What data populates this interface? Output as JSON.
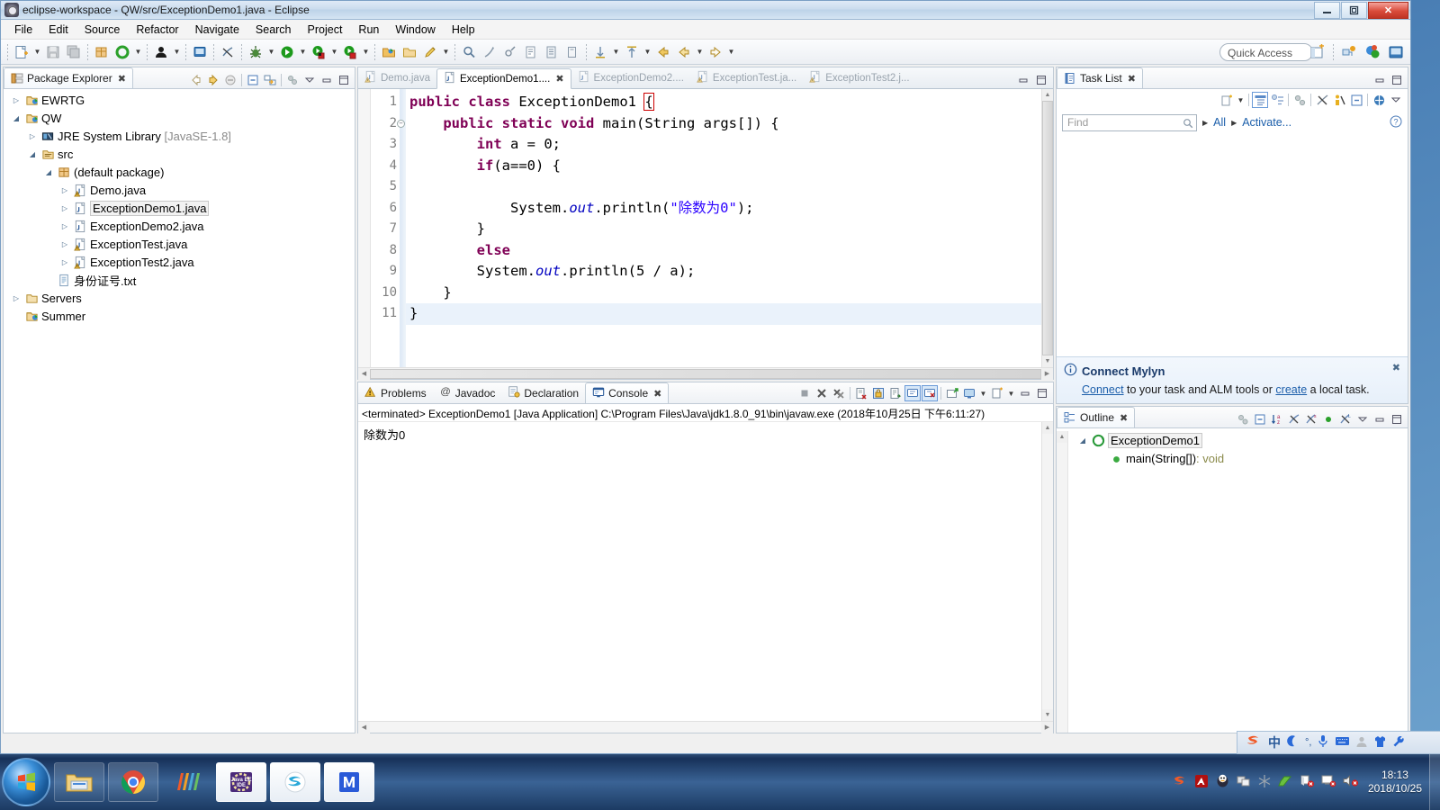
{
  "window": {
    "title": "eclipse-workspace - QW/src/ExceptionDemo1.java - Eclipse",
    "icon": "eclipse-icon",
    "minimize_label": "–",
    "maximize_label": "❐",
    "close_label": "✕"
  },
  "menu": {
    "items": [
      "File",
      "Edit",
      "Source",
      "Refactor",
      "Navigate",
      "Search",
      "Project",
      "Run",
      "Window",
      "Help"
    ]
  },
  "toolbar": {
    "quick_access_placeholder": "Quick Access",
    "quick_access_value": "Quick Access",
    "items": [
      {
        "name": "new-wizard-icon"
      },
      {
        "name": "new-dropdown-arrow"
      },
      {
        "name": "save-icon"
      },
      {
        "name": "save-all-icon"
      },
      {
        "name": "new-java-package-icon"
      },
      {
        "name": "refresh-icon"
      },
      {
        "name": "refresh-dropdown-arrow"
      },
      {
        "name": "open-type-icon"
      },
      {
        "name": "open-type-dropdown-arrow"
      },
      {
        "name": "new-java-class-icon"
      },
      {
        "name": "skip-breakpoints-icon"
      },
      {
        "name": "debug-icon"
      },
      {
        "name": "debug-dropdown-arrow"
      },
      {
        "name": "run-icon"
      },
      {
        "name": "run-dropdown-arrow"
      },
      {
        "name": "run-external-tools-icon"
      },
      {
        "name": "external-tools-dropdown-arrow"
      },
      {
        "name": "coverage-icon"
      },
      {
        "name": "coverage-dropdown-arrow"
      },
      {
        "name": "open-perspective-icon"
      },
      {
        "name": "open-resource-icon"
      },
      {
        "name": "pencil-icon"
      },
      {
        "name": "pencil-dropdown-arrow"
      },
      {
        "name": "search-icon"
      },
      {
        "name": "hierarchy-icon"
      },
      {
        "name": "annotation-icon"
      },
      {
        "name": "next-annotation-icon"
      },
      {
        "name": "previous-annotation-icon"
      },
      {
        "name": "last-edit-icon"
      },
      {
        "name": "toggle-mark-icon"
      },
      {
        "name": "mark-dropdown-arrow"
      },
      {
        "name": "next-edit-icon"
      },
      {
        "name": "next-edit-dropdown-arrow"
      },
      {
        "name": "back-icon"
      },
      {
        "name": "back-history-icon"
      },
      {
        "name": "back-dropdown-arrow"
      },
      {
        "name": "forward-icon"
      },
      {
        "name": "forward-dropdown-arrow"
      }
    ],
    "perspective_buttons": [
      {
        "name": "open-perspective-button"
      },
      {
        "name": "perspective-java-ee-button"
      },
      {
        "name": "perspective-java-button"
      },
      {
        "name": "perspective-debug-button"
      }
    ]
  },
  "package_explorer": {
    "title": "Package Explorer",
    "close_label": "✖",
    "tools": [
      {
        "name": "back-arrow-icon"
      },
      {
        "name": "forward-arrow-icon"
      },
      {
        "name": "collapse-to-parent-icon"
      },
      {
        "name": "collapse-all-icon"
      },
      {
        "name": "link-with-editor-icon"
      },
      {
        "name": "view-menu-icon"
      },
      {
        "name": "minimize-view-icon"
      },
      {
        "name": "maximize-view-icon"
      }
    ],
    "tree": [
      {
        "label": "EWRTG",
        "indent": 0,
        "twisty": "collapsed",
        "icon": "java-project-icon",
        "selected": false
      },
      {
        "label": "QW",
        "indent": 0,
        "twisty": "expanded",
        "icon": "java-project-icon",
        "selected": false
      },
      {
        "label": "JRE System Library",
        "suffix": "[JavaSE-1.8]",
        "indent": 1,
        "twisty": "collapsed",
        "icon": "library-icon",
        "selected": false
      },
      {
        "label": "src",
        "indent": 1,
        "twisty": "expanded",
        "icon": "source-folder-icon",
        "selected": false
      },
      {
        "label": "(default package)",
        "indent": 2,
        "twisty": "expanded",
        "icon": "package-icon",
        "selected": false
      },
      {
        "label": "Demo.java",
        "indent": 3,
        "twisty": "collapsed",
        "icon": "java-file-warning-icon",
        "selected": false
      },
      {
        "label": "ExceptionDemo1.java",
        "indent": 3,
        "twisty": "collapsed",
        "icon": "java-file-icon",
        "selected": true
      },
      {
        "label": "ExceptionDemo2.java",
        "indent": 3,
        "twisty": "collapsed",
        "icon": "java-file-icon",
        "selected": false
      },
      {
        "label": "ExceptionTest.java",
        "indent": 3,
        "twisty": "collapsed",
        "icon": "java-file-warning-icon",
        "selected": false
      },
      {
        "label": "ExceptionTest2.java",
        "indent": 3,
        "twisty": "collapsed",
        "icon": "java-file-warning-icon",
        "selected": false
      },
      {
        "label": "身份证号.txt",
        "indent": 2,
        "twisty": "none",
        "icon": "text-file-icon",
        "selected": false
      },
      {
        "label": "Servers",
        "indent": 0,
        "twisty": "collapsed",
        "icon": "folder-icon",
        "selected": false
      },
      {
        "label": "Summer",
        "indent": 0,
        "twisty": "none",
        "icon": "java-project-icon",
        "selected": false
      }
    ]
  },
  "editor": {
    "tabs": [
      {
        "label": "Demo.java",
        "active": false,
        "icon": "java-file-warning-icon",
        "close": ""
      },
      {
        "label": "ExceptionDemo1....",
        "active": true,
        "icon": "java-file-icon",
        "close": "✖"
      },
      {
        "label": "ExceptionDemo2....",
        "active": false,
        "icon": "java-file-icon",
        "close": ""
      },
      {
        "label": "ExceptionTest.ja...",
        "active": false,
        "icon": "java-file-warning-icon",
        "close": ""
      },
      {
        "label": "ExceptionTest2.j...",
        "active": false,
        "icon": "java-file-warning-icon",
        "close": ""
      }
    ],
    "tab_tools": [
      {
        "name": "minimize-editor-icon"
      },
      {
        "name": "maximize-editor-icon"
      }
    ],
    "line_numbers": [
      "1",
      "2",
      "3",
      "4",
      "5",
      "6",
      "7",
      "8",
      "9",
      "10",
      "11"
    ],
    "fold_line": "2",
    "current_line": 11,
    "code_lines": [
      "public class ExceptionDemo1 {",
      "    public static void main(String args[]) {",
      "        int a = 0;",
      "        if(a==0) {",
      "",
      "            System.out.println(\"除数为0\");",
      "        }",
      "        else",
      "        System.out.println(5 / a);",
      "    }",
      "}"
    ]
  },
  "console": {
    "tabs": [
      {
        "label": "Problems",
        "active": false,
        "icon": "problems-icon"
      },
      {
        "label": "Javadoc",
        "active": false,
        "icon": "javadoc-icon"
      },
      {
        "label": "Declaration",
        "active": false,
        "icon": "declaration-icon"
      },
      {
        "label": "Console",
        "active": true,
        "icon": "console-icon"
      }
    ],
    "close_label": "✖",
    "tools": [
      {
        "name": "terminate-icon"
      },
      {
        "name": "remove-launch-icon"
      },
      {
        "name": "remove-all-terminated-icon"
      },
      {
        "name": "clear-console-icon"
      },
      {
        "name": "scroll-lock-icon"
      },
      {
        "name": "word-wrap-icon"
      },
      {
        "name": "show-console-on-output-icon"
      },
      {
        "name": "show-console-on-error-icon"
      },
      {
        "name": "pin-console-icon"
      },
      {
        "name": "display-selected-console-icon"
      },
      {
        "name": "display-console-dropdown-arrow"
      },
      {
        "name": "open-console-icon"
      },
      {
        "name": "open-console-dropdown-arrow"
      },
      {
        "name": "minimize-console-icon"
      },
      {
        "name": "maximize-console-icon"
      }
    ],
    "launch_line": "<terminated> ExceptionDemo1 [Java Application] C:\\Program Files\\Java\\jdk1.8.0_91\\bin\\javaw.exe (2018年10月25日 下午6:11:27)",
    "output": "除数为0"
  },
  "task_list": {
    "title": "Task List",
    "close_label": "✖",
    "tools": [
      {
        "name": "new-task-icon"
      },
      {
        "name": "new-task-dropdown-arrow"
      },
      {
        "name": "categorized-presentation-icon"
      },
      {
        "name": "scheduled-presentation-icon"
      },
      {
        "name": "focus-on-workweek-icon"
      },
      {
        "name": "filter-completed-icon"
      },
      {
        "name": "focus-active-task-icon"
      },
      {
        "name": "collapse-all-icon"
      },
      {
        "name": "synchronize-changed-icon"
      },
      {
        "name": "view-menu-icon"
      },
      {
        "name": "minimize-view-icon"
      },
      {
        "name": "maximize-view-icon"
      }
    ],
    "find_placeholder": "Find",
    "find_value": "",
    "filter_all_label": "All",
    "activate_label": "Activate...",
    "mylyn": {
      "title": "Connect Mylyn",
      "info_icon": "info-icon",
      "text_prefix": "",
      "link_connect": "Connect",
      "text_middle": " to your task and ALM tools or ",
      "link_create": "create",
      "text_suffix": " a local task.",
      "close_label": "✖"
    }
  },
  "outline": {
    "title": "Outline",
    "close_label": "✖",
    "tools": [
      {
        "name": "focus-active-task-icon"
      },
      {
        "name": "collapse-all-icon"
      },
      {
        "name": "sort-alphabetically-icon"
      },
      {
        "name": "hide-fields-icon"
      },
      {
        "name": "hide-static-icon"
      },
      {
        "name": "hide-non-public-icon"
      },
      {
        "name": "hide-local-types-icon"
      },
      {
        "name": "view-menu-icon"
      },
      {
        "name": "minimize-view-icon"
      },
      {
        "name": "maximize-view-icon"
      }
    ],
    "items": [
      {
        "label": "ExceptionDemo1",
        "indent": 0,
        "twisty": "expanded",
        "icon": "java-class-icon",
        "type_suffix": "",
        "selected": true
      },
      {
        "label": "main(String[])",
        "type_suffix": " : void",
        "indent": 1,
        "twisty": "none",
        "icon": "public-static-method-icon",
        "selected": false
      }
    ]
  },
  "taskbar": {
    "start_label": "start-orb",
    "apps": [
      {
        "name": "taskbar-explorer-icon",
        "label": "File Explorer"
      },
      {
        "name": "taskbar-chrome-icon",
        "label": "Google Chrome"
      },
      {
        "name": "taskbar-wps-icon",
        "label": "WPS"
      },
      {
        "name": "taskbar-eclipse-icon",
        "label": "Java EE IDE"
      },
      {
        "name": "taskbar-sogou-icon",
        "label": "Sogou"
      },
      {
        "name": "taskbar-wps-writer-icon",
        "label": "WPS Writer"
      }
    ],
    "tray_icons": [
      {
        "name": "tray-sogou-icon"
      },
      {
        "name": "tray-adobe-icon"
      },
      {
        "name": "tray-qq-icon"
      },
      {
        "name": "tray-network-share-icon"
      },
      {
        "name": "tray-snowflake-icon"
      },
      {
        "name": "tray-green-shield-icon"
      },
      {
        "name": "tray-network-error-icon"
      },
      {
        "name": "tray-monitor-icon"
      },
      {
        "name": "tray-volume-muted-icon"
      }
    ],
    "ime_bar": [
      {
        "name": "ime-sogou-logo",
        "label": "S"
      },
      {
        "name": "ime-chinese-mode",
        "label": "中"
      },
      {
        "name": "ime-moon-icon",
        "label": ""
      },
      {
        "name": "ime-punctuation-icon",
        "label": "°,"
      },
      {
        "name": "ime-voice-icon",
        "label": ""
      },
      {
        "name": "ime-keyboard-icon",
        "label": ""
      },
      {
        "name": "ime-user-icon",
        "label": ""
      },
      {
        "name": "ime-skin-icon",
        "label": ""
      },
      {
        "name": "ime-toolbox-icon",
        "label": ""
      }
    ],
    "clock_time": "18:13",
    "clock_date": "2018/10/25"
  },
  "colors": {
    "keyword": "#7f0055",
    "string": "#2a00ff",
    "field": "#0000c0",
    "link": "#1b5eaa",
    "selection": "#eaf2fb"
  }
}
